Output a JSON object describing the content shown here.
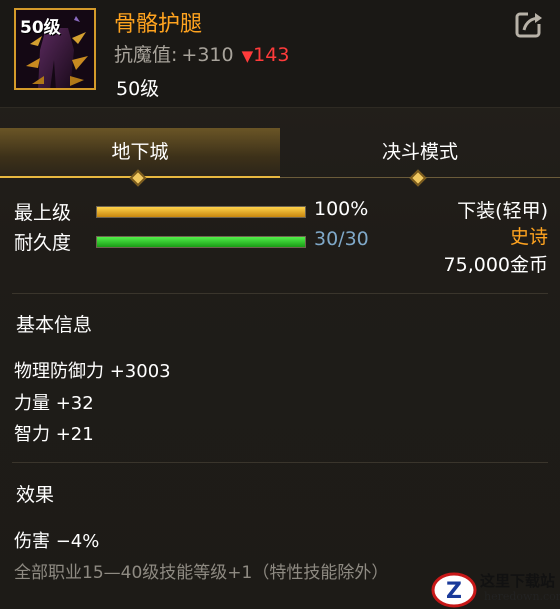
{
  "item": {
    "level_badge": "50级",
    "name": "骨骼护腿",
    "resist_label": "抗魔值:",
    "resist_value": "+310",
    "resist_delta_arrow": "▼",
    "resist_delta": "143",
    "level_text": "50级",
    "icon": "share-icon"
  },
  "tabs": [
    {
      "label": "地下城",
      "active": true
    },
    {
      "label": "决斗模式",
      "active": false
    }
  ],
  "stats": {
    "upgrade_label": "最上级",
    "upgrade_value": "100%",
    "upgrade_fraction": 1.0,
    "durability_label": "耐久度",
    "durability_value": "30/30",
    "durability_fraction": 1.0
  },
  "meta": {
    "slot": "下装(轻甲)",
    "rarity": "史诗",
    "price": "75,000金币"
  },
  "basic": {
    "title": "基本信息",
    "lines": [
      "物理防御力 +3003",
      "力量 +32",
      "智力 +21"
    ]
  },
  "effects": {
    "title": "效果",
    "lines": [
      "伤害 −4%",
      "全部职业15—40级技能等级+1（特性技能除外）"
    ]
  },
  "watermark": {
    "title": "这里下载站",
    "url": "heredown.com"
  },
  "colors": {
    "item_name": "#ffa31f",
    "rarity": "#ffa31f",
    "delta": "#ff3b3b",
    "durability_value": "#7fa8c8",
    "frame": "#d49a2a"
  }
}
